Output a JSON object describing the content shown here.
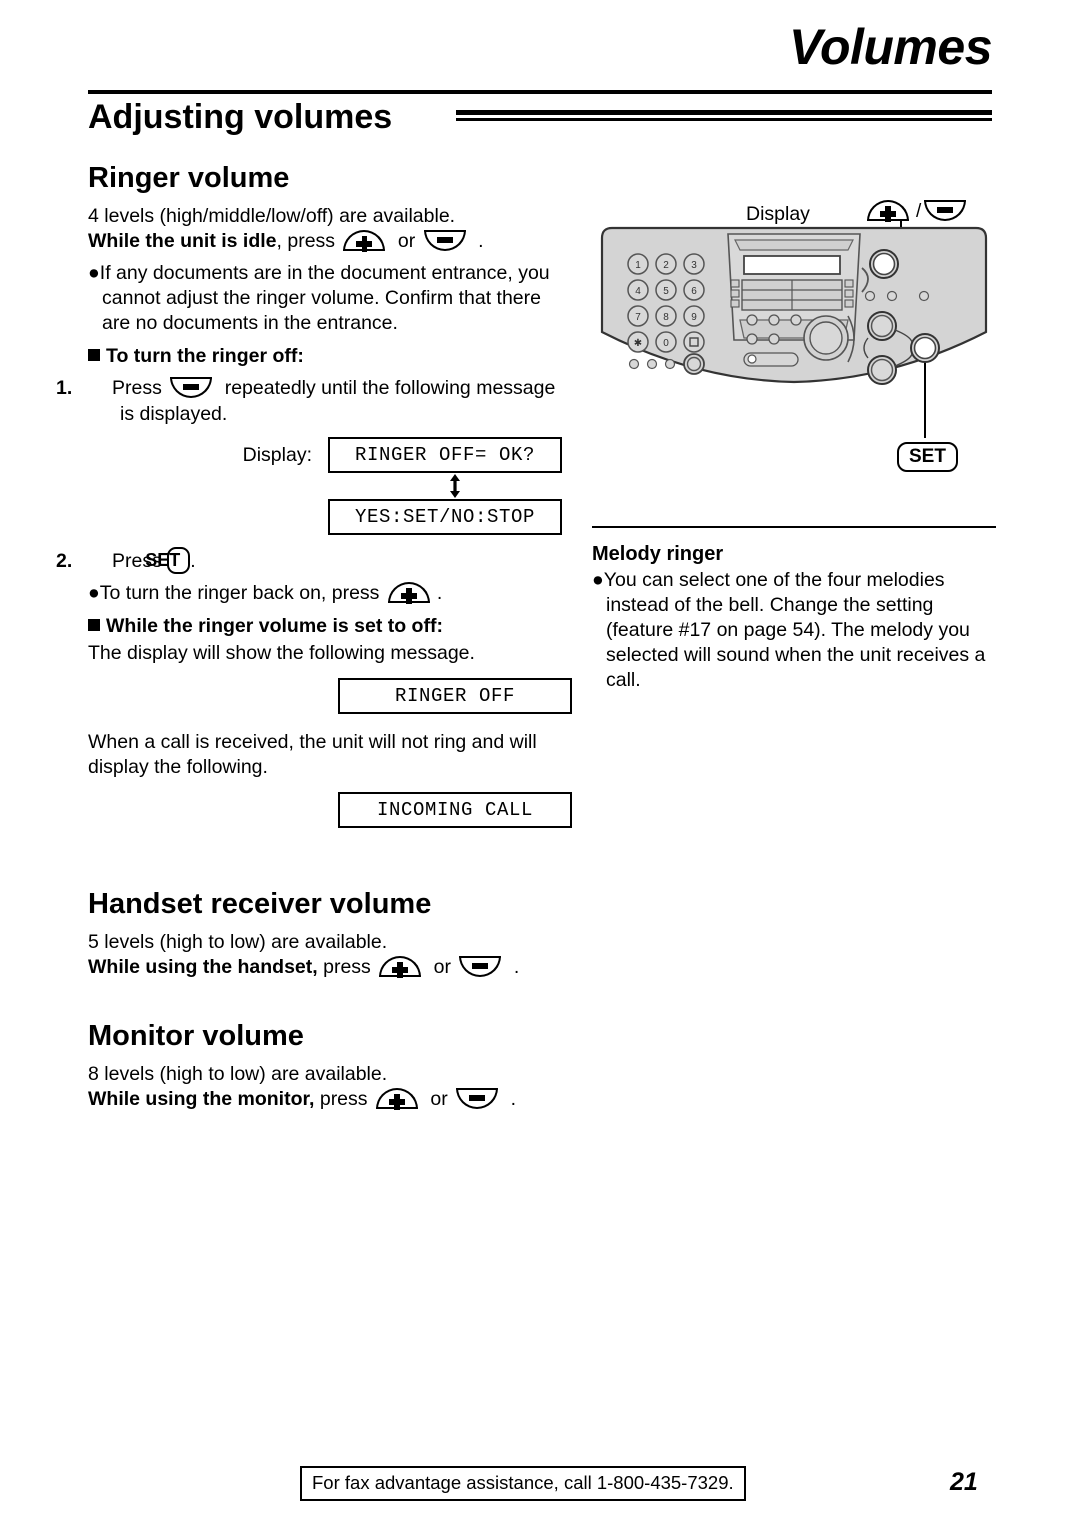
{
  "page": {
    "chapter_title": "Volumes",
    "section_title": "Adjusting volumes",
    "page_number": "21"
  },
  "footer": {
    "note": "For fax advantage assistance, call 1-800-435-7329."
  },
  "ringer_volume": {
    "heading": "Ringer volume",
    "levels_line": "4 levels (high/middle/low/off) are available.",
    "press_bold": "While the unit is idle",
    "press_rest": ", press",
    "or_word": "or",
    "period": ".",
    "bullet_documents": "If any documents are in the document entrance, you cannot adjust the ringer volume. Confirm that there are no documents in the entrance.",
    "turn_off_heading": "To turn the ringer off:",
    "step1_num": "1.",
    "step1_pre": "Press",
    "step1_post": "repeatedly until the following message is displayed.",
    "display_label": "Display:",
    "lcd_ringer_off_ok": "RINGER OFF= OK?",
    "lcd_yes_set_no_stop": "YES:SET/NO:STOP",
    "step2_num": "2.",
    "step2_pre": "Press",
    "step2_set": "SET",
    "step2_post": ".",
    "bullet_back_on_pre": "To turn the ringer back on, press",
    "bullet_back_on_post": ".",
    "set_to_off_heading": "While the ringer volume is set to off:",
    "set_to_off_body": "The display will show the following message.",
    "lcd_ringer_off": "RINGER OFF",
    "incoming_body": "When a call is received, the unit will not ring and will display the following.",
    "lcd_incoming_call": "INCOMING CALL"
  },
  "handset_receiver_volume": {
    "heading": "Handset receiver volume",
    "levels_line": "5 levels (high to low) are available.",
    "press_bold": "While using the handset,",
    "press_rest": "press",
    "or_word": "or",
    "period": "."
  },
  "monitor_volume": {
    "heading": "Monitor volume",
    "levels_line": "8 levels (high to low) are available.",
    "press_bold": "While using the monitor,",
    "press_rest": "press",
    "or_word": "or",
    "period": "."
  },
  "figure": {
    "display_callout": "Display",
    "volume_callout_sep": "/",
    "set_callout": "SET",
    "keypad": [
      "1",
      "2",
      "3",
      "4",
      "5",
      "6",
      "7",
      "8",
      "9",
      "*",
      "0",
      "#"
    ],
    "panel_color": "#d4d4d4"
  },
  "melody_ringer": {
    "heading": "Melody ringer",
    "bullet": "You can select one of the four melodies instead of the bell. Change the setting (feature #17 on page 54). The melody you selected will sound when the unit receives a call."
  }
}
